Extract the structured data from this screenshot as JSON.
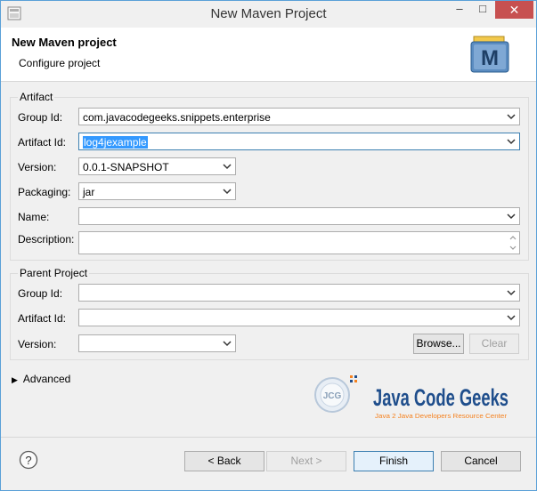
{
  "window": {
    "title": "New Maven Project",
    "minimize_glyph": "–",
    "maximize_glyph": "□",
    "close_glyph": "✕"
  },
  "header": {
    "title": "New Maven project",
    "subtitle": "Configure project",
    "icon_letter": "M"
  },
  "artifact": {
    "group_label": "Artifact",
    "group_id": {
      "label": "Group Id:",
      "value": "com.javacodegeeks.snippets.enterprise"
    },
    "artifact_id": {
      "label": "Artifact Id:",
      "value": "log4jexample"
    },
    "version": {
      "label": "Version:",
      "value": "0.0.1-SNAPSHOT"
    },
    "packaging": {
      "label": "Packaging:",
      "value": "jar"
    },
    "name": {
      "label": "Name:",
      "value": ""
    },
    "description": {
      "label": "Description:",
      "value": ""
    }
  },
  "parent": {
    "group_label": "Parent Project",
    "group_id": {
      "label": "Group Id:",
      "value": ""
    },
    "artifact_id": {
      "label": "Artifact Id:",
      "value": ""
    },
    "version": {
      "label": "Version:",
      "value": ""
    },
    "browse_label": "Browse...",
    "clear_label": "Clear"
  },
  "advanced_label": "Advanced",
  "watermark": {
    "brand": "Java Code Geeks",
    "tagline": "Java 2 Java Developers Resource Center",
    "badge": "JCG"
  },
  "footer": {
    "help_glyph": "?",
    "back_label": "< Back",
    "next_label": "Next >",
    "finish_label": "Finish",
    "cancel_label": "Cancel"
  },
  "colors": {
    "selection": "#3399ff",
    "close_button": "#c75050",
    "maven_icon_blue": "#2a5d8f",
    "maven_icon_yellow": "#f2c94c",
    "jcg_orange": "#f58220",
    "jcg_blue": "#1f4e8c"
  }
}
